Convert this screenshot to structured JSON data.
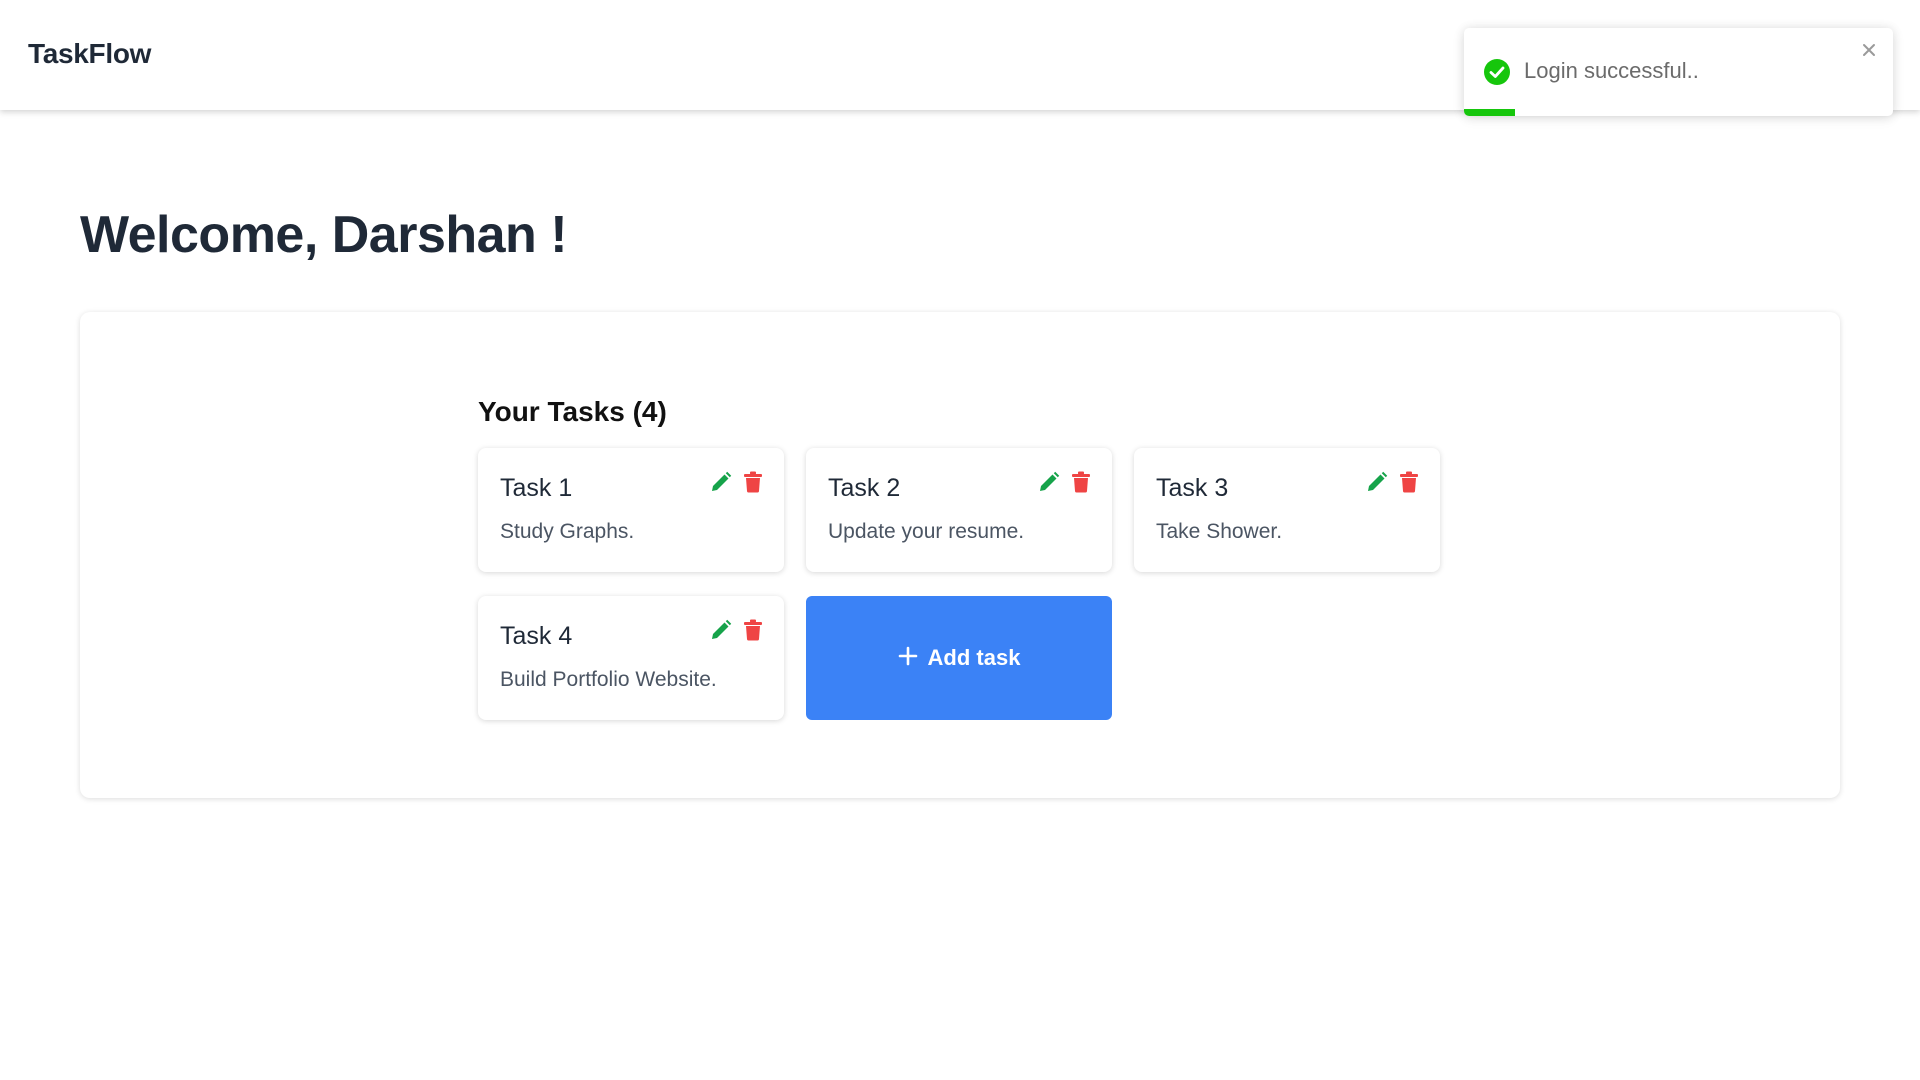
{
  "app": {
    "brand": "TaskFlow"
  },
  "toast": {
    "message": "Login successful..",
    "icon": "check-circle-icon",
    "close_icon": "close-icon",
    "progress": 0.12,
    "color": "#16c60c"
  },
  "main": {
    "welcome": "Welcome, Darshan !",
    "tasks_heading": "Your Tasks (4)",
    "tasks": [
      {
        "title": "Task 1",
        "description": "Study Graphs."
      },
      {
        "title": "Task 2",
        "description": "Update your resume."
      },
      {
        "title": "Task 3",
        "description": "Take Shower."
      },
      {
        "title": "Task 4",
        "description": "Build Portfolio Website."
      }
    ],
    "add_task_label": "Add task"
  },
  "colors": {
    "edit_icon": "#16a34a",
    "delete_icon": "#ef4444",
    "add_button": "#3b82f6"
  }
}
